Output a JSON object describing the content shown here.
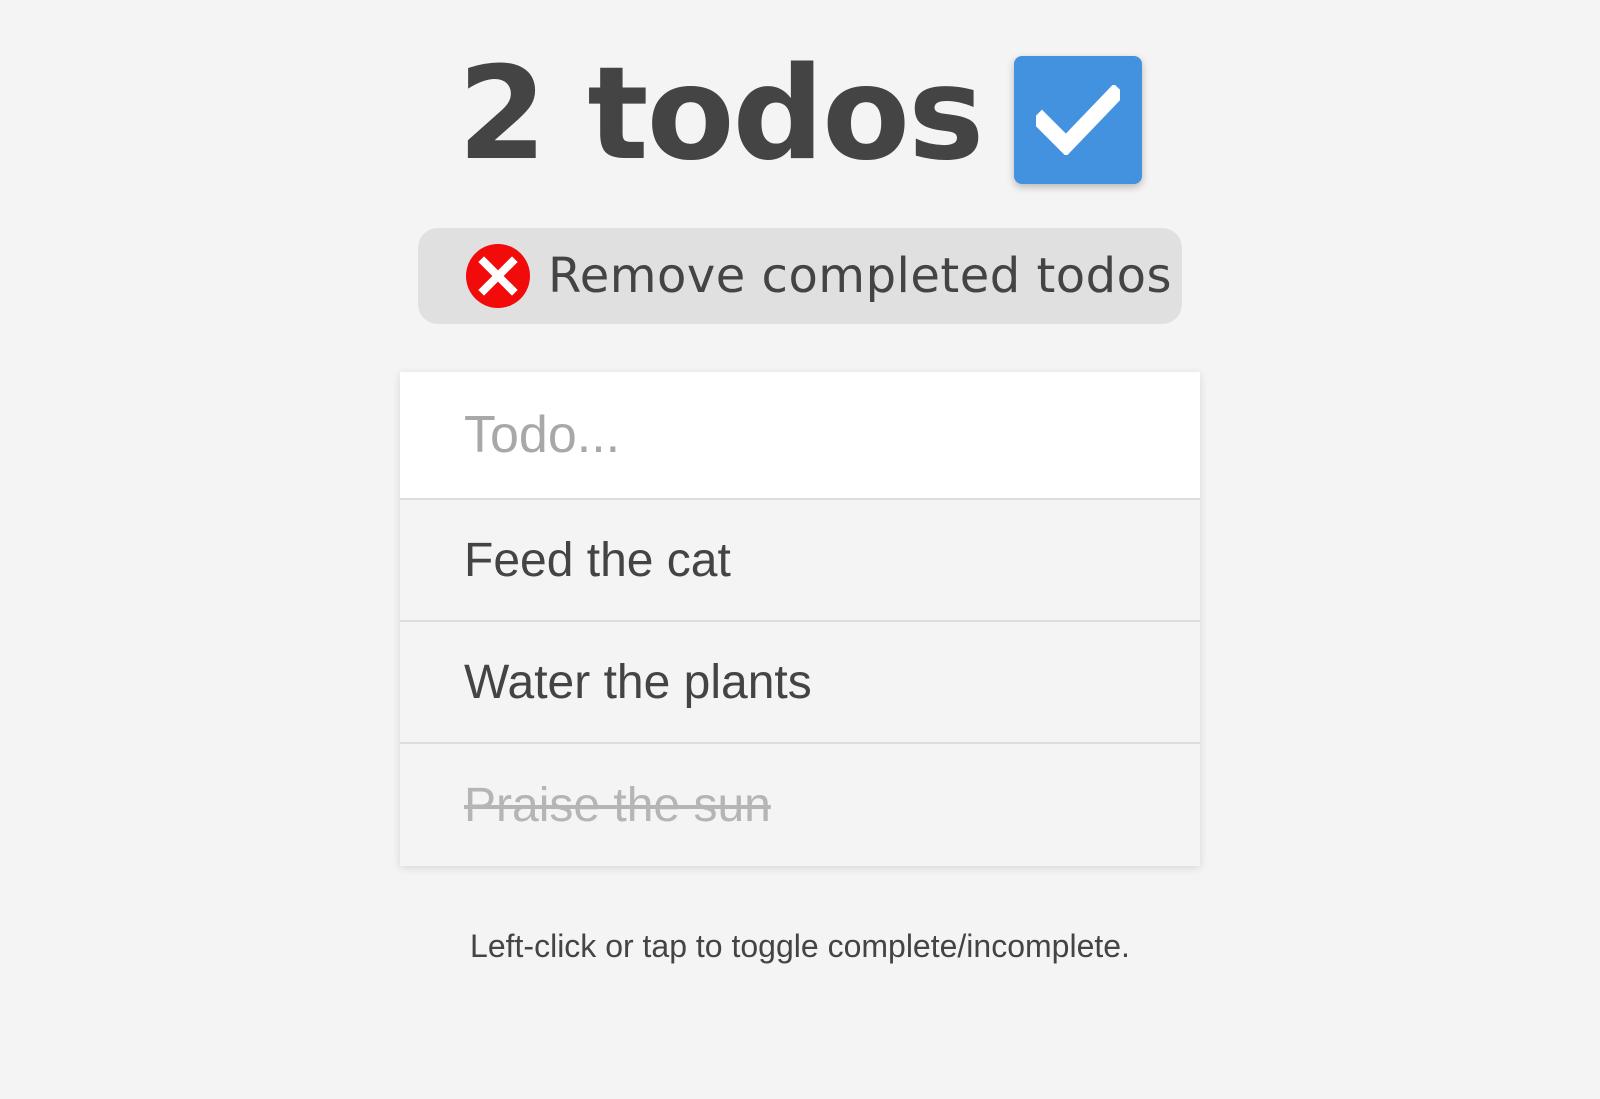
{
  "header": {
    "title": "2 todos",
    "toggle_all_icon": "checkmark-icon"
  },
  "remove_completed": {
    "label": "Remove completed todos",
    "icon": "close-circle-icon"
  },
  "new_todo": {
    "placeholder": "Todo...",
    "value": ""
  },
  "todos": [
    {
      "text": "Feed the cat",
      "completed": false
    },
    {
      "text": "Water the plants",
      "completed": false
    },
    {
      "text": "Praise the sun",
      "completed": true
    }
  ],
  "hint": "Left-click or tap to toggle complete/incomplete.",
  "colors": {
    "background": "#f4f4f4",
    "accent": "#4392e0",
    "danger": "#f20b0b",
    "text": "#444444",
    "completed_text": "#b5b5b5"
  }
}
